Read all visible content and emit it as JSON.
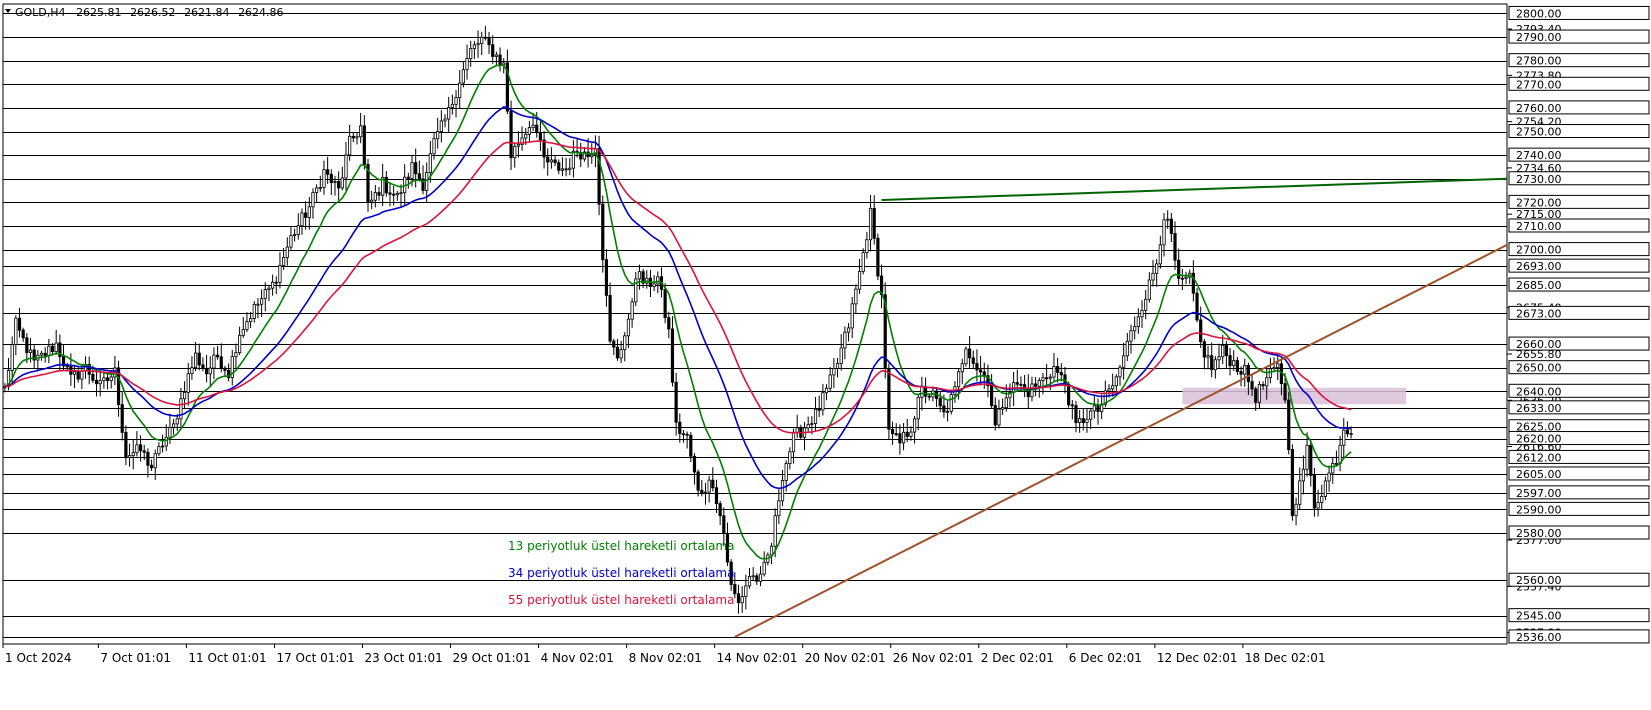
{
  "header": {
    "symbol": "GOLD,H4",
    "open": "2625.81",
    "high": "2626.52",
    "low": "2621.84",
    "close": "2624.86"
  },
  "legend": {
    "ema13": "13 periyotluk üstel hareketli ortalama",
    "ema34": "34 periyotluk üstel hareketli ortalama",
    "ema55": "55 periyotluk üstel hareketli ortalama"
  },
  "colors": {
    "ema13": "#008000",
    "ema34": "#0000cd",
    "ema55": "#dc143c",
    "resistance_line": "#006400",
    "support_line": "#a0522d",
    "zone": "#d8bfd8",
    "candle": "#000000",
    "grid": "#000000"
  },
  "chart_data": {
    "type": "candlestick",
    "ylim": [
      2533,
      2804
    ],
    "bars": 410,
    "price_levels": [
      "2800.00",
      "2790.00",
      "2780.00",
      "2770.00",
      "2760.00",
      "2750.00",
      "2740.00",
      "2730.00",
      "2720.00",
      "2710.00",
      "2700.00",
      "2693.00",
      "2685.00",
      "2673.00",
      "2660.00",
      "2650.00",
      "2640.00",
      "2633.00",
      "2625.00",
      "2620.00",
      "2612.00",
      "2605.00",
      "2597.00",
      "2590.00",
      "2580.00",
      "2560.00",
      "2545.00",
      "2536.00"
    ],
    "minor_labels": [
      "2793.40",
      "2773.80",
      "2754.20",
      "2734.60",
      "2715.00",
      "2675.40",
      "2655.80",
      "2636.20",
      "2616.60",
      "2577.00",
      "2557.40",
      "2537.80"
    ],
    "x_labels": [
      {
        "label": "1 Oct 2024",
        "bar": 0
      },
      {
        "label": "7 Oct 01:01",
        "bar": 26
      },
      {
        "label": "11 Oct 01:01",
        "bar": 50
      },
      {
        "label": "17 Oct 01:01",
        "bar": 74
      },
      {
        "label": "23 Oct 01:01",
        "bar": 98
      },
      {
        "label": "29 Oct 01:01",
        "bar": 122
      },
      {
        "label": "4 Nov 02:01",
        "bar": 146
      },
      {
        "label": "8 Nov 02:01",
        "bar": 170
      },
      {
        "label": "14 Nov 02:01",
        "bar": 194
      },
      {
        "label": "20 Nov 02:01",
        "bar": 218
      },
      {
        "label": "26 Nov 02:01",
        "bar": 242
      },
      {
        "label": "2 Dec 02:01",
        "bar": 266
      },
      {
        "label": "6 Dec 02:01",
        "bar": 290
      },
      {
        "label": "12 Dec 02:01",
        "bar": 314
      },
      {
        "label": "18 Dec 02:01",
        "bar": 338
      }
    ],
    "price_path": [
      [
        0,
        2641
      ],
      [
        3,
        2668
      ],
      [
        8,
        2652
      ],
      [
        14,
        2660
      ],
      [
        18,
        2645
      ],
      [
        22,
        2650
      ],
      [
        26,
        2642
      ],
      [
        30,
        2648
      ],
      [
        33,
        2613
      ],
      [
        37,
        2615
      ],
      [
        40,
        2608
      ],
      [
        43,
        2618
      ],
      [
        46,
        2625
      ],
      [
        49,
        2642
      ],
      [
        52,
        2655
      ],
      [
        55,
        2648
      ],
      [
        58,
        2655
      ],
      [
        61,
        2648
      ],
      [
        64,
        2665
      ],
      [
        68,
        2675
      ],
      [
        73,
        2685
      ],
      [
        78,
        2705
      ],
      [
        83,
        2718
      ],
      [
        87,
        2733
      ],
      [
        91,
        2725
      ],
      [
        94,
        2745
      ],
      [
        97,
        2752
      ],
      [
        99,
        2718
      ],
      [
        103,
        2728
      ],
      [
        107,
        2722
      ],
      [
        111,
        2735
      ],
      [
        114,
        2728
      ],
      [
        117,
        2745
      ],
      [
        121,
        2758
      ],
      [
        124,
        2772
      ],
      [
        127,
        2784
      ],
      [
        130,
        2789
      ],
      [
        133,
        2784
      ],
      [
        136,
        2778
      ],
      [
        138,
        2740
      ],
      [
        141,
        2748
      ],
      [
        144,
        2755
      ],
      [
        147,
        2738
      ],
      [
        150,
        2735
      ],
      [
        153,
        2734
      ],
      [
        156,
        2742
      ],
      [
        159,
        2740
      ],
      [
        161,
        2745
      ],
      [
        163,
        2698
      ],
      [
        165,
        2660
      ],
      [
        167,
        2655
      ],
      [
        170,
        2668
      ],
      [
        172,
        2690
      ],
      [
        175,
        2685
      ],
      [
        178,
        2688
      ],
      [
        181,
        2665
      ],
      [
        183,
        2625
      ],
      [
        186,
        2620
      ],
      [
        189,
        2597
      ],
      [
        193,
        2602
      ],
      [
        196,
        2580
      ],
      [
        198,
        2557
      ],
      [
        200,
        2550
      ],
      [
        203,
        2562
      ],
      [
        206,
        2560
      ],
      [
        209,
        2575
      ],
      [
        212,
        2605
      ],
      [
        215,
        2620
      ],
      [
        218,
        2625
      ],
      [
        221,
        2630
      ],
      [
        224,
        2640
      ],
      [
        227,
        2652
      ],
      [
        230,
        2668
      ],
      [
        233,
        2690
      ],
      [
        236,
        2715
      ],
      [
        239,
        2680
      ],
      [
        241,
        2622
      ],
      [
        244,
        2618
      ],
      [
        247,
        2625
      ],
      [
        250,
        2640
      ],
      [
        253,
        2638
      ],
      [
        256,
        2630
      ],
      [
        259,
        2640
      ],
      [
        262,
        2660
      ],
      [
        265,
        2650
      ],
      [
        268,
        2645
      ],
      [
        270,
        2625
      ],
      [
        273,
        2640
      ],
      [
        276,
        2643
      ],
      [
        279,
        2640
      ],
      [
        283,
        2645
      ],
      [
        286,
        2650
      ],
      [
        289,
        2643
      ],
      [
        292,
        2625
      ],
      [
        295,
        2630
      ],
      [
        298,
        2632
      ],
      [
        301,
        2640
      ],
      [
        303,
        2645
      ],
      [
        306,
        2660
      ],
      [
        309,
        2673
      ],
      [
        312,
        2685
      ],
      [
        314,
        2695
      ],
      [
        316,
        2715
      ],
      [
        318,
        2705
      ],
      [
        320,
        2685
      ],
      [
        323,
        2688
      ],
      [
        326,
        2660
      ],
      [
        329,
        2650
      ],
      [
        332,
        2657
      ],
      [
        335,
        2652
      ],
      [
        338,
        2648
      ],
      [
        341,
        2638
      ],
      [
        344,
        2645
      ],
      [
        347,
        2650
      ],
      [
        349,
        2638
      ],
      [
        351,
        2590
      ],
      [
        353,
        2600
      ],
      [
        355,
        2615
      ],
      [
        357,
        2592
      ],
      [
        359,
        2598
      ],
      [
        361,
        2605
      ],
      [
        363,
        2612
      ],
      [
        365,
        2625
      ],
      [
        367,
        2624
      ]
    ],
    "series": [
      {
        "name": "13 periyotluk üstel hareketli ortalama",
        "key": "ema13"
      },
      {
        "name": "34 periyotluk üstel hareketli ortalama",
        "key": "ema34"
      },
      {
        "name": "55 periyotluk üstel hareketli ortalama",
        "key": "ema55"
      }
    ],
    "trendlines": [
      {
        "key": "resistance_line",
        "from": {
          "bar": 239,
          "price": 2721
        },
        "to": {
          "bar": 410,
          "price": 2730
        }
      },
      {
        "key": "support_line",
        "from": {
          "bar": 199,
          "price": 2536
        },
        "to": {
          "bar": 410,
          "price": 2702
        }
      }
    ],
    "zone": {
      "bar_from": 321,
      "bar_to": 382,
      "price_high": 2641.5,
      "price_low": 2634.5
    },
    "grid": "horizontal"
  }
}
